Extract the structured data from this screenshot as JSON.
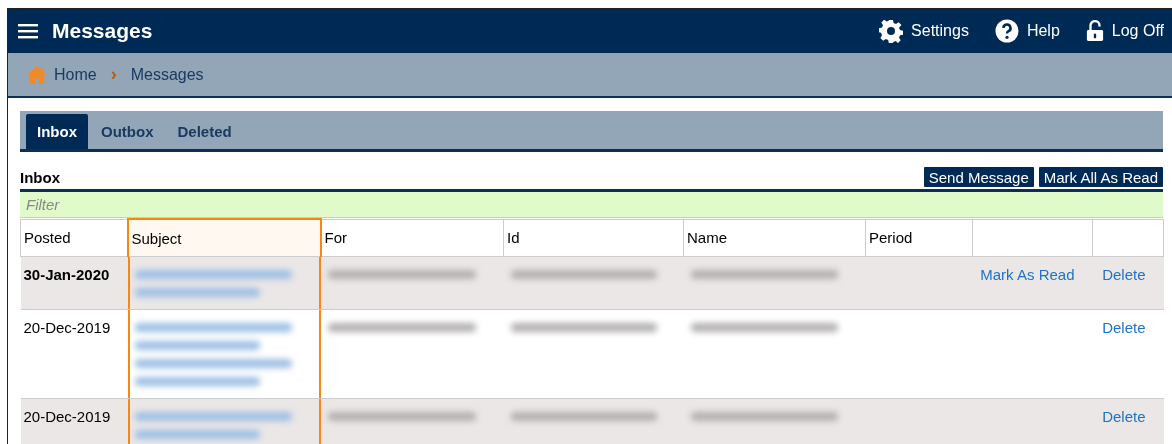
{
  "header": {
    "title": "Messages",
    "actions": [
      {
        "kind": "settings",
        "label": "Settings"
      },
      {
        "kind": "help",
        "label": "Help"
      },
      {
        "kind": "logoff",
        "label": "Log Off"
      }
    ]
  },
  "breadcrumb": {
    "items": [
      "Home",
      "Messages"
    ],
    "separator": "›"
  },
  "tabs": [
    {
      "label": "Inbox",
      "selected": true
    },
    {
      "label": "Outbox",
      "selected": false
    },
    {
      "label": "Deleted",
      "selected": false
    }
  ],
  "section": {
    "title": "Inbox",
    "buttons": [
      "Send Message",
      "Mark All As Read"
    ]
  },
  "filter": {
    "placeholder": "Filter"
  },
  "table": {
    "columns": [
      {
        "label": "Posted",
        "highlighted": false
      },
      {
        "label": "Subject",
        "highlighted": true
      },
      {
        "label": "For",
        "highlighted": false
      },
      {
        "label": "Id",
        "highlighted": false
      },
      {
        "label": "Name",
        "highlighted": false
      },
      {
        "label": "Period",
        "highlighted": false
      },
      {
        "highlighted": false
      },
      {
        "highlighted": false
      }
    ],
    "rows": [
      {
        "unread": true,
        "cells": [
          {
            "kind": "text",
            "text": "30-Jan-2020"
          },
          {
            "kind": "blurred-link"
          },
          {
            "kind": "blurred"
          },
          {
            "kind": "blurred"
          },
          {
            "kind": "blurred"
          },
          {
            "kind": "empty"
          },
          {
            "kind": "link",
            "text": "Mark As Read"
          },
          {
            "kind": "link",
            "text": "Delete"
          }
        ]
      },
      {
        "unread": false,
        "cells": [
          {
            "kind": "text",
            "text": "20-Dec-2019"
          },
          {
            "kind": "blurred-link-long"
          },
          {
            "kind": "blurred"
          },
          {
            "kind": "blurred"
          },
          {
            "kind": "blurred"
          },
          {
            "kind": "empty"
          },
          {
            "kind": "empty"
          },
          {
            "kind": "link",
            "text": "Delete"
          }
        ]
      },
      {
        "unread": false,
        "cells": [
          {
            "kind": "text",
            "text": "20-Dec-2019"
          },
          {
            "kind": "blurred-link"
          },
          {
            "kind": "blurred"
          },
          {
            "kind": "blurred"
          },
          {
            "kind": "blurred"
          },
          {
            "kind": "empty"
          },
          {
            "kind": "empty"
          },
          {
            "kind": "link",
            "text": "Delete"
          }
        ]
      }
    ]
  }
}
